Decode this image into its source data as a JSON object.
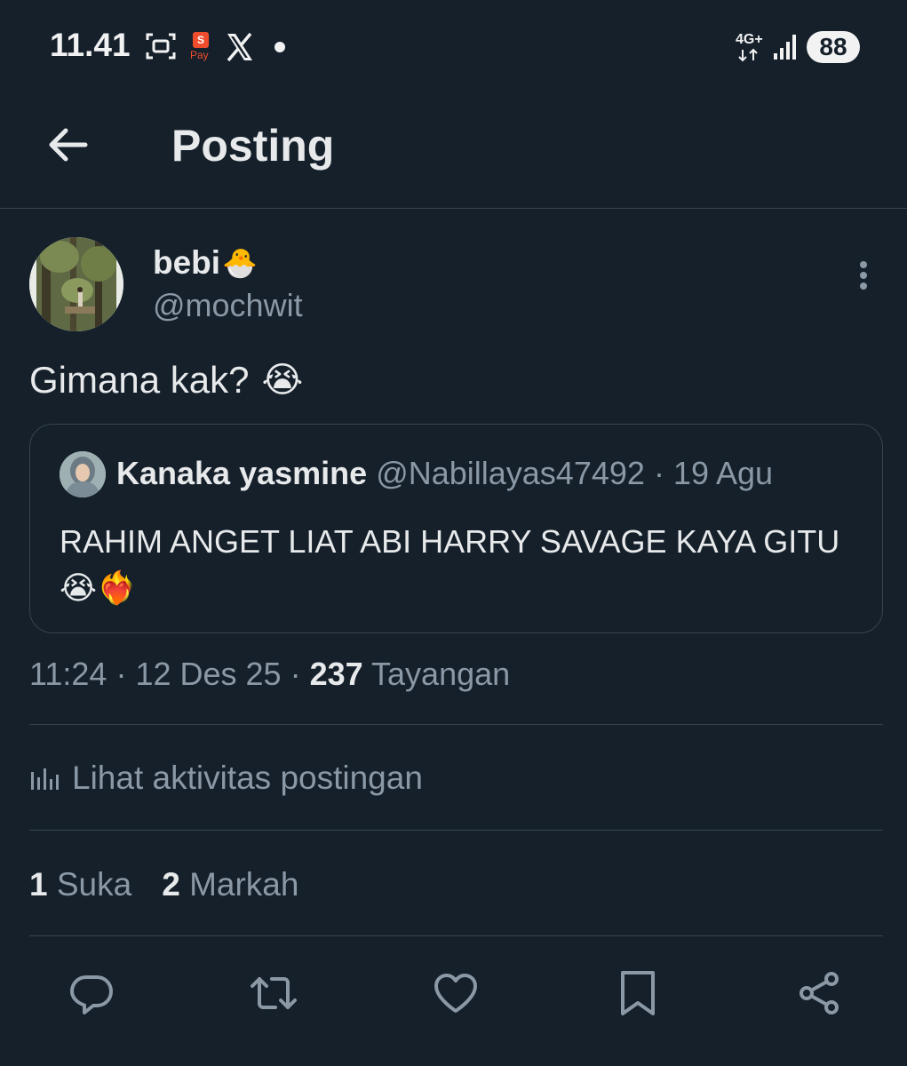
{
  "status_bar": {
    "time": "11.41",
    "network": "4G+",
    "battery": "88",
    "icons": [
      "screenshot-icon",
      "shopeepay-icon",
      "x-logo-icon",
      "notification-dot-icon",
      "data-arrows-icon",
      "signal-icon"
    ],
    "pay_icon_text": "S",
    "pay_label": "Pay"
  },
  "header": {
    "title": "Posting",
    "back_icon": "arrow-left-icon"
  },
  "post": {
    "author_name": "bebi",
    "author_emoji": "🐣",
    "author_handle": "@mochwit",
    "text": "Gimana kak?",
    "text_emoji": "😭",
    "quote": {
      "name": "Kanaka yasmine",
      "handle": "@Nabillayas47492",
      "date": "· 19 Agu",
      "text": "RAHIM ANGET LIAT ABI HARRY SAVAGE KAYA GITU😭❤️‍🔥"
    },
    "meta": {
      "time": "11:24",
      "date": "12 Des 25",
      "views_count": "237",
      "views_label": "Tayangan",
      "separator": "·"
    },
    "activity_label": "Lihat aktivitas postingan",
    "stats": {
      "likes_count": "1",
      "likes_label": "Suka",
      "bookmarks_count": "2",
      "bookmarks_label": "Markah"
    }
  },
  "actions": [
    "reply-icon",
    "repost-icon",
    "like-icon",
    "bookmark-icon",
    "share-icon"
  ],
  "colors": {
    "background": "#15202b",
    "text_primary": "#e7e9ea",
    "text_secondary": "#8b98a5",
    "border": "#38444d"
  }
}
